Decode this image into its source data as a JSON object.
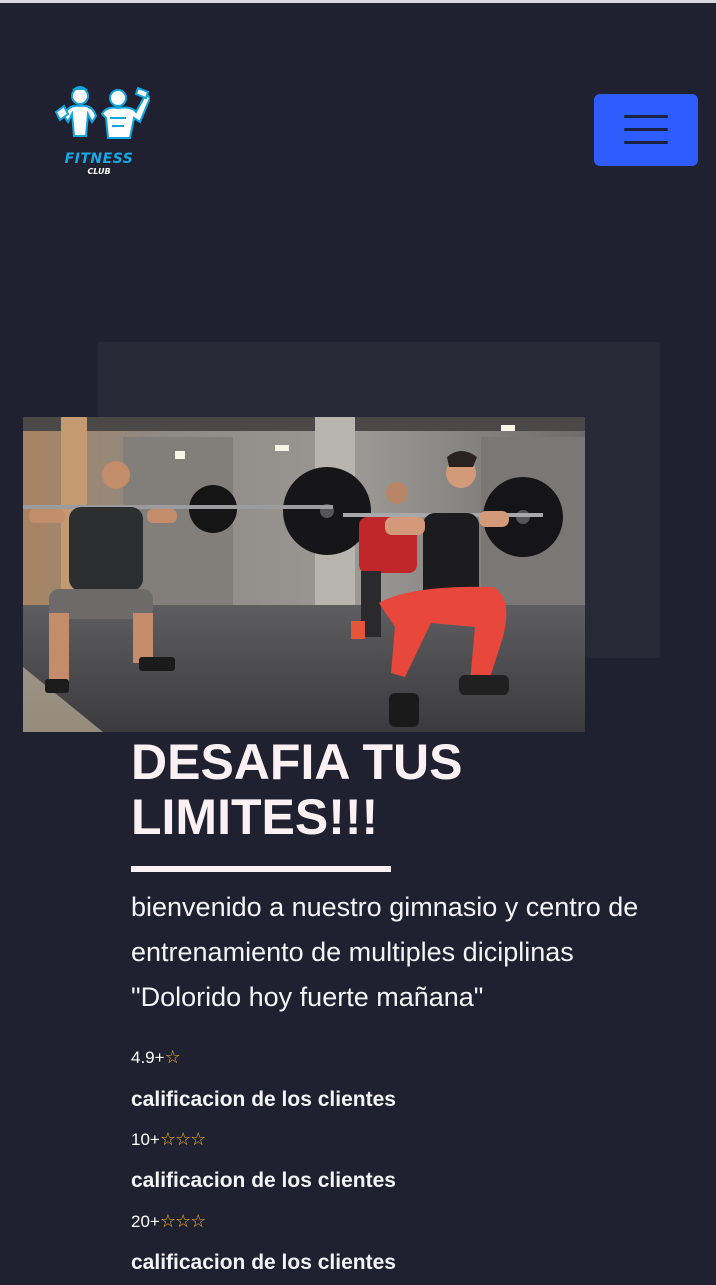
{
  "header": {
    "logo": {
      "title": "FITNESS",
      "subtitle": "CLUB",
      "icon": "bodybuilders-logo-icon",
      "color": "#19a9e6"
    },
    "menu_button": {
      "icon": "hamburger-menu-icon",
      "color": "#2f5cff"
    }
  },
  "hero": {
    "image": "gym-squat-photo",
    "headline_line1": "DESAFIA TUS",
    "headline_line2": "LIMITES!!!",
    "intro_line1": "bienvenido a nuestro gimnasio y centro de",
    "intro_line2": "entrenamiento de multiples diciplinas",
    "intro_line3": "\"Dolorido hoy fuerte mañana\""
  },
  "stats": [
    {
      "value": "4.9+",
      "stars": "☆",
      "label": "calificacion de los clientes"
    },
    {
      "value": "10+",
      "stars": "☆☆☆",
      "label": "calificacion de los clientes"
    },
    {
      "value": "20+",
      "stars": "☆☆☆",
      "label": "calificacion de los clientes"
    }
  ],
  "colors": {
    "background": "#1f2030",
    "accent": "#2f5cff",
    "star": "#f0b429"
  }
}
